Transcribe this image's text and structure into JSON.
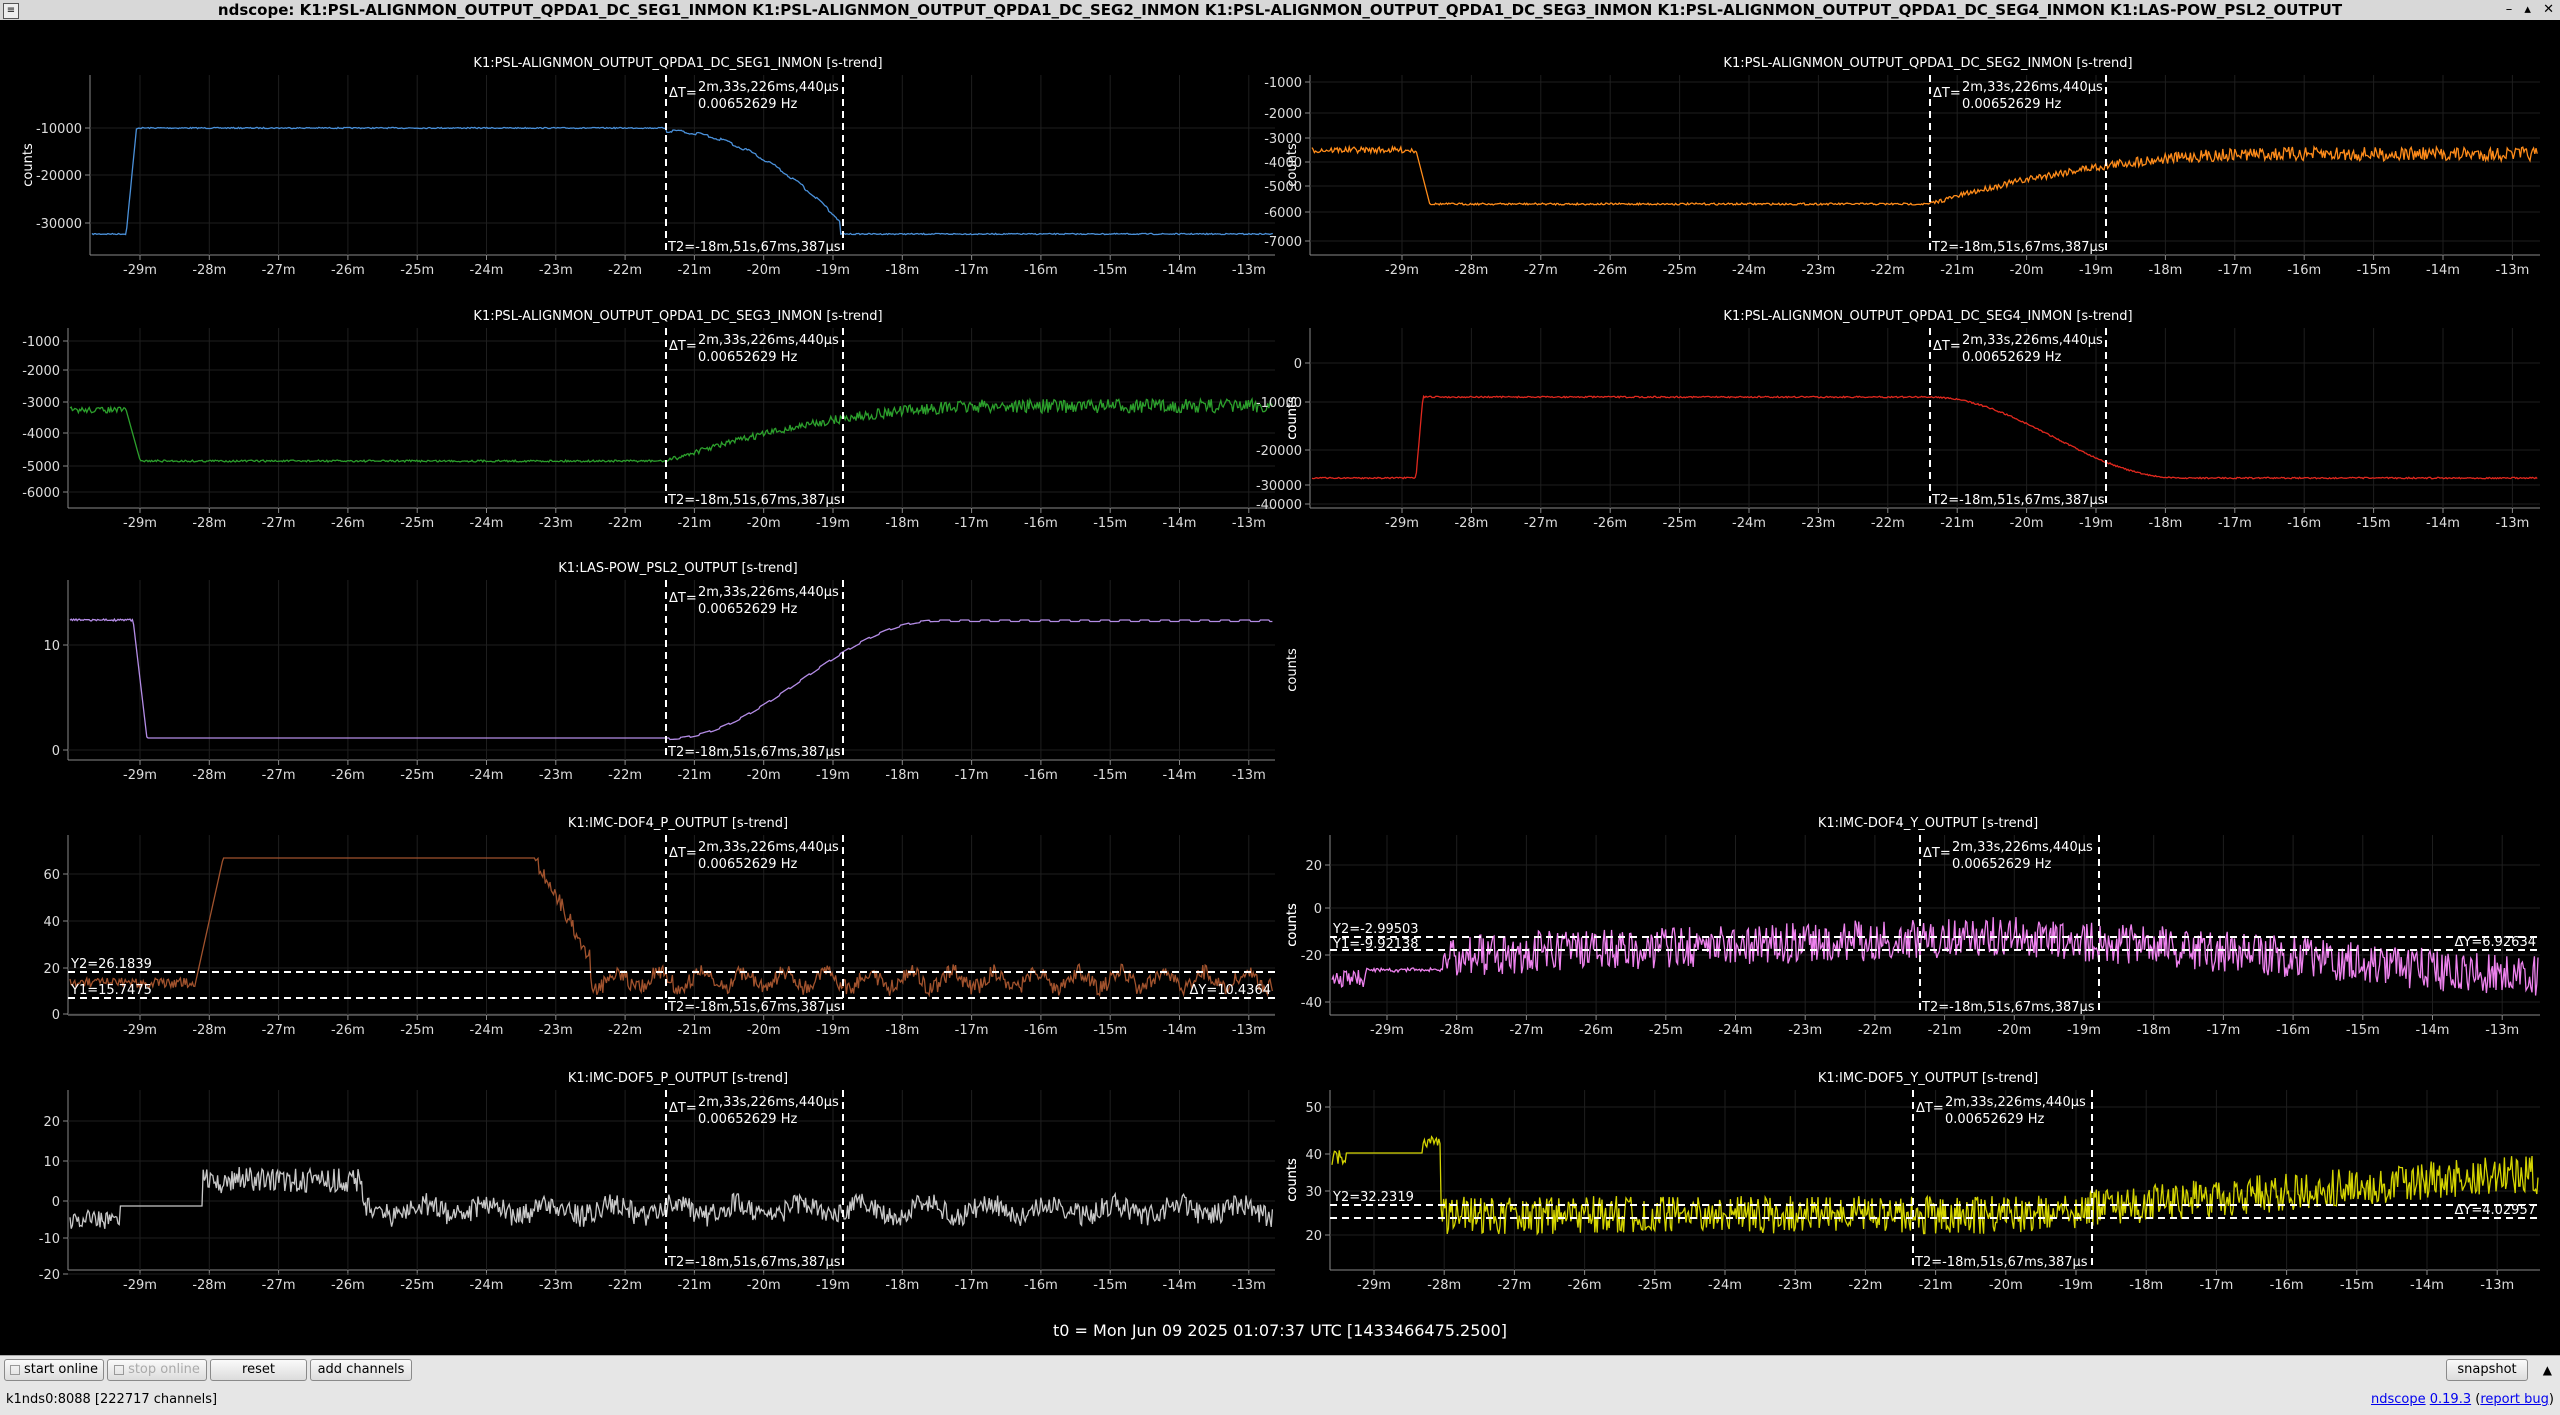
{
  "window": {
    "title": "ndscope: K1:PSL-ALIGNMON_OUTPUT_QPDA1_DC_SEG1_INMON K1:PSL-ALIGNMON_OUTPUT_QPDA1_DC_SEG2_INMON K1:PSL-ALIGNMON_OUTPUT_QPDA1_DC_SEG3_INMON K1:PSL-ALIGNMON_OUTPUT_QPDA1_DC_SEG4_INMON K1:LAS-POW_PSL2_OUTPUT",
    "controls": [
      "–",
      "▴",
      "✕"
    ]
  },
  "cursors": {
    "delta_t": "2m,33s,226ms,440µs",
    "delta_t_label": "ΔT=",
    "freq": "0.00652629 Hz",
    "t2": "T2=-18m,51s,67ms,387µs",
    "t1_minutes": -21.45,
    "t2_minutes": -18.9
  },
  "x_ticks": [
    "-29m",
    "-28m",
    "-27m",
    "-26m",
    "-25m",
    "-24m",
    "-23m",
    "-22m",
    "-21m",
    "-20m",
    "-19m",
    "-18m",
    "-17m",
    "-16m",
    "-15m",
    "-14m",
    "-13m"
  ],
  "y_axis_label": "counts",
  "plots": [
    {
      "id": "seg1",
      "title": "K1:PSL-ALIGNMON_OUTPUT_QPDA1_DC_SEG1_INMON [s-trend]",
      "color": "#4a90d9",
      "yticks": [
        "-10000",
        "-20000",
        "-30000"
      ],
      "shape": "seg1"
    },
    {
      "id": "seg2",
      "title": "K1:PSL-ALIGNMON_OUTPUT_QPDA1_DC_SEG2_INMON [s-trend]",
      "color": "#ff8c1a",
      "yticks": [
        "-1000",
        "-2000",
        "-3000",
        "-4000",
        "-5000",
        "-6000",
        "-7000"
      ],
      "shape": "seg2"
    },
    {
      "id": "seg3",
      "title": "K1:PSL-ALIGNMON_OUTPUT_QPDA1_DC_SEG3_INMON [s-trend]",
      "color": "#2ca02c",
      "yticks": [
        "-1000",
        "-2000",
        "-3000",
        "-4000",
        "-5000",
        "-6000"
      ],
      "shape": "seg3"
    },
    {
      "id": "seg4",
      "title": "K1:PSL-ALIGNMON_OUTPUT_QPDA1_DC_SEG4_INMON [s-trend]",
      "color": "#e0281e",
      "yticks": [
        "0",
        "-10000",
        "-20000",
        "-30000",
        "-40000"
      ],
      "shape": "seg4"
    },
    {
      "id": "pow",
      "title": "K1:LAS-POW_PSL2_OUTPUT [s-trend]",
      "color": "#b48ce6",
      "yticks": [
        "10",
        "0"
      ],
      "shape": "pow"
    },
    {
      "id": "dof4p",
      "title": "K1:IMC-DOF4_P_OUTPUT [s-trend]",
      "color": "#a0522d",
      "yticks": [
        "60",
        "40",
        "20",
        "0"
      ],
      "shape": "dof4p",
      "ycursors": {
        "y2": "Y2=26.1839",
        "y1": "Y1=15.7475",
        "dy": "ΔY=10.4364"
      }
    },
    {
      "id": "dof4y",
      "title": "K1:IMC-DOF4_Y_OUTPUT [s-trend]",
      "color": "#ee82ee",
      "yticks": [
        "20",
        "0",
        "-20",
        "-40"
      ],
      "shape": "dof4y",
      "ycursors": {
        "y2": "Y2=-2.99503",
        "y1": "Y1=-9.92138",
        "dy": "ΔY=6.92634"
      }
    },
    {
      "id": "dof5p",
      "title": "K1:IMC-DOF5_P_OUTPUT [s-trend]",
      "color": "#c8c8c8",
      "yticks": [
        "20",
        "10",
        "0",
        "-10",
        "-20"
      ],
      "shape": "dof5p"
    },
    {
      "id": "dof5y",
      "title": "K1:IMC-DOF5_Y_OUTPUT [s-trend]",
      "color": "#d4d400",
      "yticks": [
        "50",
        "40",
        "30",
        "20"
      ],
      "shape": "dof5y",
      "ycursors": {
        "y2": "Y2=32.2319",
        "dy": "ΔY=4.02957"
      }
    }
  ],
  "t0": "t0 = Mon Jun 09 2025 01:07:37 UTC [1433466475.2500]",
  "buttons": {
    "start_online": "start online",
    "stop_online": "stop online",
    "reset": "reset",
    "add_channels": "add channels",
    "snapshot": "snapshot"
  },
  "status": "k1nds0:8088  [222717 channels]",
  "links": {
    "app": "ndscope",
    "version": "0.19.3",
    "report": "report bug"
  }
}
